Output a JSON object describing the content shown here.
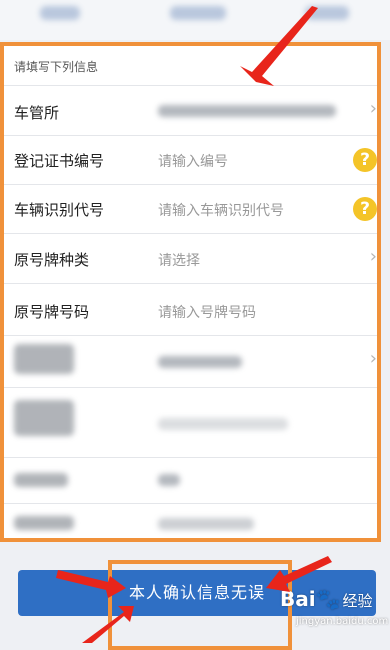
{
  "form": {
    "section_title": "请填写下列信息",
    "rows": [
      {
        "label": "车管所",
        "value": "",
        "control": "chevron"
      },
      {
        "label": "登记证书编号",
        "placeholder": "请输入编号",
        "control": "help"
      },
      {
        "label": "车辆识别代号",
        "placeholder": "请输入车辆识别代号",
        "control": "help"
      },
      {
        "label": "原号牌种类",
        "placeholder": "请选择",
        "control": "chevron"
      },
      {
        "label": "原号牌号码",
        "placeholder": "请输入号牌号码",
        "control": "none"
      }
    ]
  },
  "confirm_button": {
    "label": "本人确认信息无误"
  },
  "icons": {
    "chevron": "chevron-right-icon",
    "help": "question-mark-icon"
  },
  "watermark": {
    "brand": "Bai",
    "paw": "🐾",
    "suffix": "经验",
    "url": "jingyan.baidu.com"
  },
  "colors": {
    "accent_orange": "#f0913a",
    "annotation_red": "#e8251b",
    "button_blue": "#2f6fc4",
    "help_yellow": "#f4c428"
  }
}
